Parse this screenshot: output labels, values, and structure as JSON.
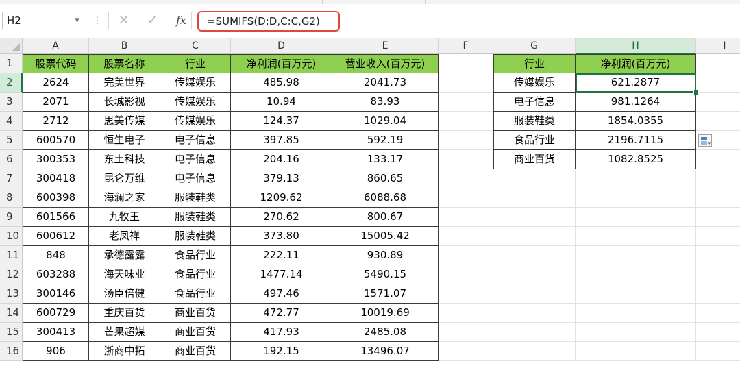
{
  "formula_bar": {
    "name_box": "H2",
    "cancel_glyph": "✕",
    "enter_glyph": "✓",
    "fx_label": "fx",
    "formula": "=SUMIFS(D:D,C:C,G2)"
  },
  "columns": [
    "A",
    "B",
    "C",
    "D",
    "E",
    "F",
    "G",
    "H",
    "I"
  ],
  "selected_column": "H",
  "selected_row": "2",
  "rows": [
    "1",
    "2",
    "3",
    "4",
    "5",
    "6",
    "7",
    "8",
    "9",
    "10",
    "11",
    "12",
    "13",
    "14",
    "15",
    "16"
  ],
  "table1": {
    "headers": [
      "股票代码",
      "股票名称",
      "行业",
      "净利润(百万元)",
      "营业收入(百万元)"
    ],
    "rows": [
      [
        "2624",
        "完美世界",
        "传媒娱乐",
        "485.98",
        "2041.73"
      ],
      [
        "2071",
        "长城影视",
        "传媒娱乐",
        "10.94",
        "83.93"
      ],
      [
        "2712",
        "思美传媒",
        "传媒娱乐",
        "124.37",
        "1029.04"
      ],
      [
        "600570",
        "恒生电子",
        "电子信息",
        "397.85",
        "592.19"
      ],
      [
        "300353",
        "东土科技",
        "电子信息",
        "204.16",
        "133.17"
      ],
      [
        "300418",
        "昆仑万维",
        "电子信息",
        "379.13",
        "860.65"
      ],
      [
        "600398",
        "海澜之家",
        "服装鞋类",
        "1209.62",
        "6088.68"
      ],
      [
        "601566",
        "九牧王",
        "服装鞋类",
        "270.62",
        "800.67"
      ],
      [
        "600612",
        "老凤祥",
        "服装鞋类",
        "373.80",
        "15005.42"
      ],
      [
        "848",
        "承德露露",
        "食品行业",
        "222.11",
        "930.89"
      ],
      [
        "603288",
        "海天味业",
        "食品行业",
        "1477.14",
        "5490.15"
      ],
      [
        "300146",
        "汤臣倍健",
        "食品行业",
        "497.46",
        "1571.07"
      ],
      [
        "600729",
        "重庆百货",
        "商业百货",
        "472.77",
        "10019.69"
      ],
      [
        "300413",
        "芒果超媒",
        "商业百货",
        "417.93",
        "2485.08"
      ],
      [
        "906",
        "浙商中拓",
        "商业百货",
        "192.15",
        "13496.07"
      ]
    ]
  },
  "table2": {
    "headers": [
      "行业",
      "净利润(百万元)"
    ],
    "rows": [
      [
        "传媒娱乐",
        "621.2877"
      ],
      [
        "电子信息",
        "981.1264"
      ],
      [
        "服装鞋类",
        "1854.0355"
      ],
      [
        "食品行业",
        "2196.7115"
      ],
      [
        "商业百货",
        "1082.8525"
      ]
    ]
  },
  "colors": {
    "header_fill": "#8fcf4f",
    "selection": "#217346",
    "formula_highlight": "#e2463b"
  }
}
